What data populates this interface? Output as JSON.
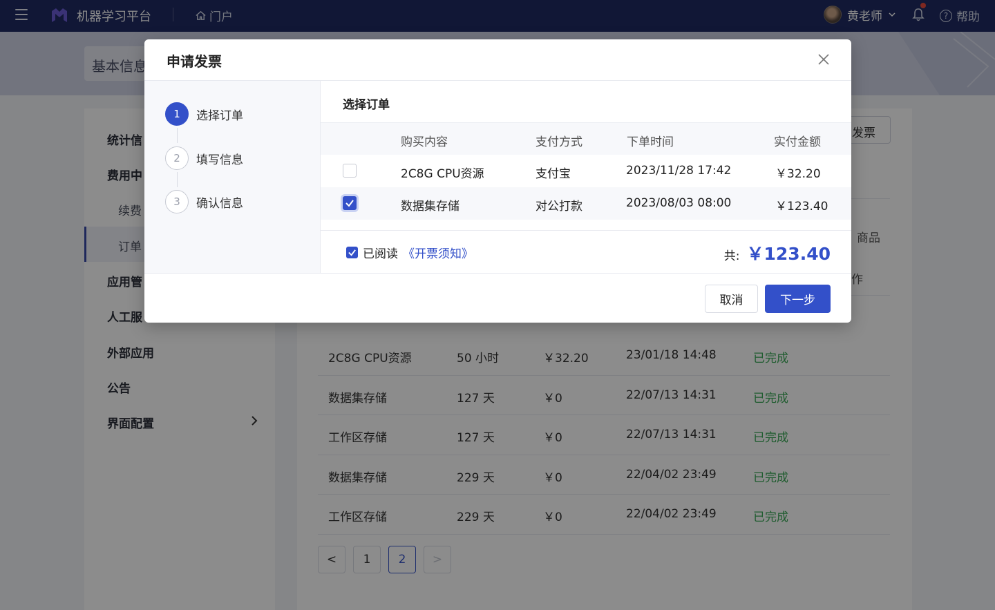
{
  "topbar": {
    "app_title": "机器学习平台",
    "portal_label": "门户",
    "user_name": "黄老师",
    "help_label": "帮助"
  },
  "page": {
    "tab_basic": "基本信息",
    "apply_invoice_btn": "发票",
    "ghost_header_goods": "商品",
    "ghost_header_action": "作"
  },
  "sidebar": {
    "items": [
      {
        "label": "统计信"
      },
      {
        "label": "费用中"
      },
      {
        "label": "续费"
      },
      {
        "label": "订单"
      },
      {
        "label": "应用管"
      },
      {
        "label": "人工服"
      },
      {
        "label": "外部应用"
      },
      {
        "label": "公告"
      },
      {
        "label": "界面配置"
      }
    ]
  },
  "orders": [
    {
      "name": "2C8G CPU资源",
      "duration": "50 小时",
      "price": "￥32.20",
      "time": "23/01/18 14:48",
      "status": "已完成"
    },
    {
      "name": "数据集存储",
      "duration": "127 天",
      "price": "￥0",
      "time": "22/07/13 14:31",
      "status": "已完成"
    },
    {
      "name": "工作区存储",
      "duration": "127 天",
      "price": "￥0",
      "time": "22/07/13 14:31",
      "status": "已完成"
    },
    {
      "name": "数据集存储",
      "duration": "229 天",
      "price": "￥0",
      "time": "22/04/02 23:49",
      "status": "已完成"
    },
    {
      "name": "工作区存储",
      "duration": "229 天",
      "price": "￥0",
      "time": "22/04/02 23:49",
      "status": "已完成"
    }
  ],
  "pagination": {
    "prev": "<",
    "pages": [
      "1",
      "2"
    ],
    "next": ">",
    "current": "2"
  },
  "modal": {
    "title": "申请发票",
    "steps": [
      {
        "num": "1",
        "label": "选择订单"
      },
      {
        "num": "2",
        "label": "填写信息"
      },
      {
        "num": "3",
        "label": "确认信息"
      }
    ],
    "section_title": "选择订单",
    "columns": [
      "购买内容",
      "支付方式",
      "下单时间",
      "实付金额"
    ],
    "rows": [
      {
        "content": "2C8G CPU资源",
        "payment": "支付宝",
        "time": "2023/11/28 17:42",
        "amount": "￥32.20",
        "checked": false
      },
      {
        "content": "数据集存储",
        "payment": "对公打款",
        "time": "2023/08/03 08:00",
        "amount": "￥123.40",
        "checked": true
      }
    ],
    "agree_text": "已阅读",
    "agree_link": "《开票须知》",
    "total_label": "共:",
    "total_amount": "￥123.40",
    "cancel_label": "取消",
    "next_label": "下一步"
  },
  "colors": {
    "primary": "#3350c9",
    "topbar": "#1f2a63",
    "success": "#3aa856"
  }
}
